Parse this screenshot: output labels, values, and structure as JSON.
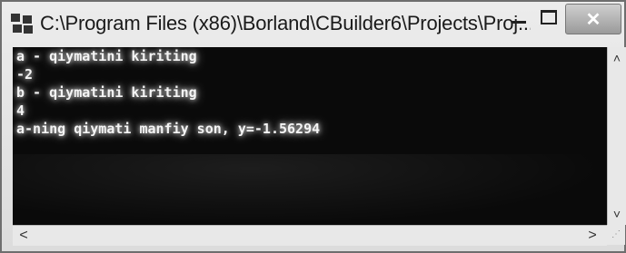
{
  "window": {
    "title": "C:\\Program Files (x86)\\Borland\\CBuilder6\\Projects\\Proj...",
    "icon": "cbuilder-app-icon",
    "buttons": {
      "minimize_icon": "minimize-icon",
      "maximize_icon": "maximize-icon",
      "close_label": "✕"
    }
  },
  "console": {
    "lines": [
      "a - qiymatini kiriting",
      "-2",
      "b - qiymatini kiriting",
      "4",
      "a-ning qiymati manfiy son, y=-1.56294"
    ]
  },
  "scrollbars": {
    "up_arrow": "˄",
    "down_arrow": "˅",
    "left_arrow": "<",
    "right_arrow": ">",
    "grip": "⋰"
  },
  "colors": {
    "console_bg": "#0a0a0a",
    "console_text": "#f4f4f4",
    "chrome": "#dcdcdc"
  }
}
